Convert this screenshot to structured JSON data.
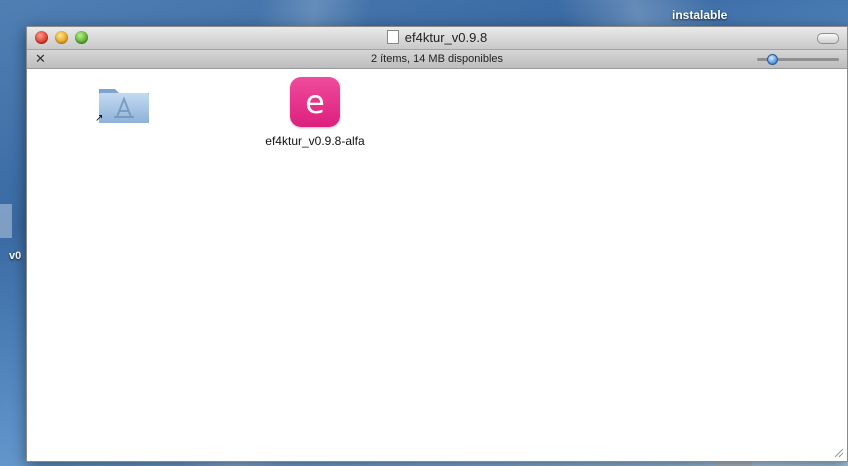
{
  "desktop": {
    "label_top_right": "instalable",
    "label_left_partial": "v0"
  },
  "window": {
    "title": "ef4ktur_v0.9.8",
    "status_text": "2 ítems, 14 MB disponibles",
    "items": [
      {
        "name": "",
        "icon": "applications-folder-alias-icon"
      },
      {
        "name": "ef4ktur_v0.9.8-alfa",
        "icon": "app-e-icon",
        "glyph": "e"
      }
    ]
  },
  "colors": {
    "app_icon": "#e8328a",
    "folder": "#a9c6e6",
    "close": "#d7301f",
    "minimize": "#e09a13",
    "zoom": "#4aa325"
  }
}
